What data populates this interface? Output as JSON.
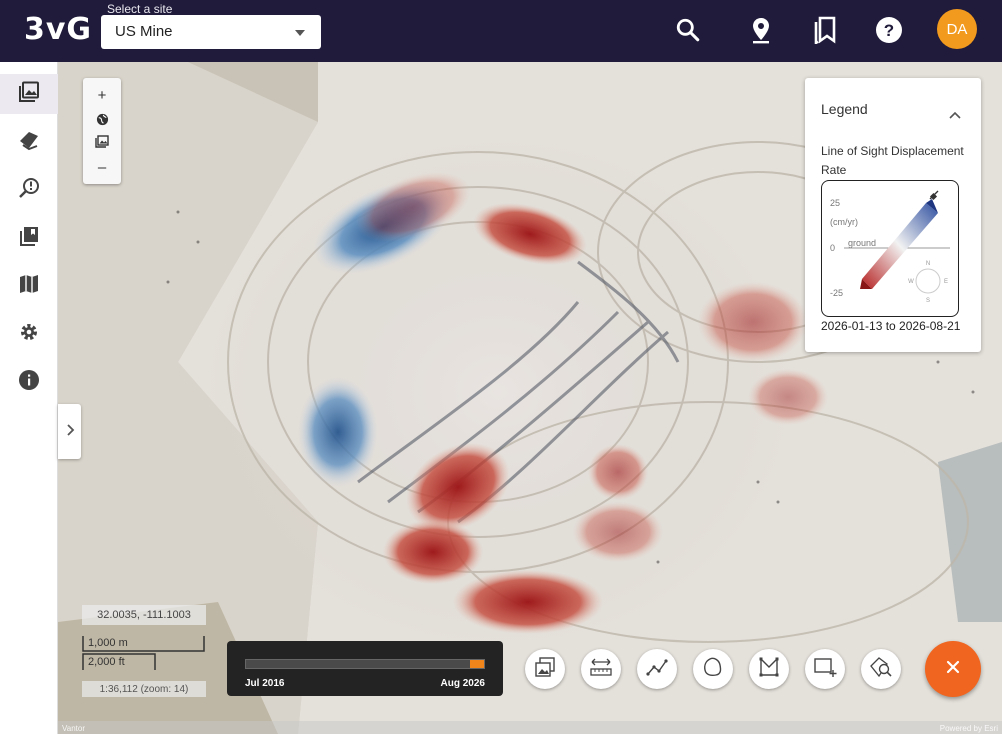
{
  "header": {
    "logo": "3vG",
    "site_select_label": "Select a site",
    "site_selected": "US Mine",
    "icons": [
      "search-icon",
      "location-pin-icon",
      "bookmarks-icon",
      "help-icon"
    ],
    "avatar_initials": "DA",
    "avatar_color": "#f29a1d",
    "background": "#201b3a"
  },
  "sidebar": {
    "items": [
      {
        "icon": "image-layers-icon",
        "active": true
      },
      {
        "icon": "layers-stack-icon"
      },
      {
        "icon": "alert-search-icon"
      },
      {
        "icon": "library-icon"
      },
      {
        "icon": "map-icon"
      },
      {
        "icon": "settings-icon"
      },
      {
        "icon": "info-icon"
      }
    ]
  },
  "map_controls": {
    "zoom_in": "+",
    "zoom_out": "–",
    "icons": [
      "globe-icon",
      "image-icon"
    ]
  },
  "legend": {
    "title": "Legend",
    "subtitle": "Line of Sight Displacement Rate",
    "max_label": "25",
    "unit_label": "(cm/yr)",
    "zero_label": "0",
    "ground_label": "ground",
    "min_label": "-25",
    "compass": {
      "n": "N",
      "w": "W",
      "e": "E",
      "s": "S"
    },
    "date_range": "2026-01-13 to 2026-08-21",
    "colors": {
      "positive": "#2e4fa0",
      "neutral": "#f2f2f2",
      "negative": "#b51f1f"
    }
  },
  "coordinates": "32.0035, -111.1003",
  "scale": {
    "metric": "1,000 m",
    "imperial": "2,000 ft"
  },
  "zoom_info": "1:36,112 (zoom: 14)",
  "timeline": {
    "start": "Jul 2016",
    "end": "Aug 2026",
    "accent": "#f0851c",
    "selected_fraction": 0.06
  },
  "tools": [
    "image-compare-icon",
    "measure-distance-icon",
    "polyline-icon",
    "polygon-icon",
    "area-icon",
    "add-rectangle-icon",
    "inspect-search-icon"
  ],
  "fab": {
    "icon": "close-icon",
    "color": "#f0651f"
  },
  "attribution": {
    "left": "Vantor",
    "right": "Powered by Esri"
  }
}
